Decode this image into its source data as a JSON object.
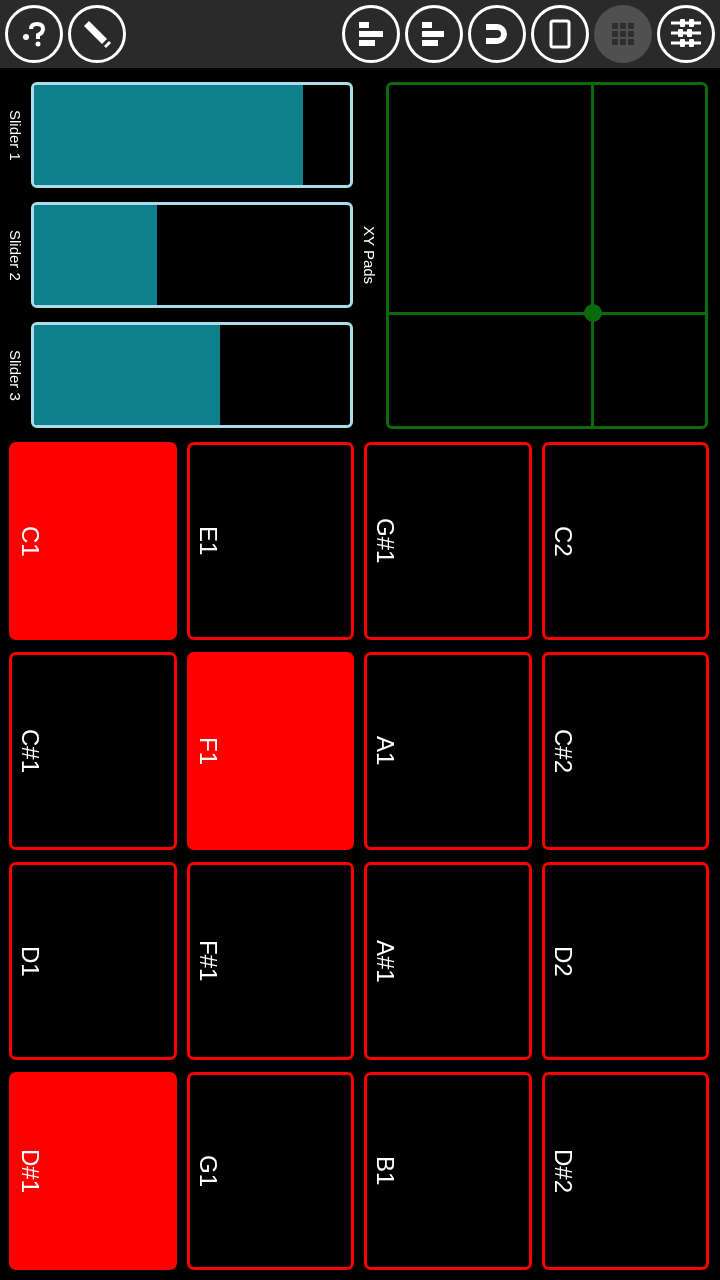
{
  "toolbar": {
    "left_buttons": [
      {
        "kind": "help",
        "selected": false
      },
      {
        "kind": "pencil",
        "selected": false
      }
    ],
    "right_buttons": [
      {
        "kind": "align-left",
        "selected": false
      },
      {
        "kind": "align-center",
        "selected": false
      },
      {
        "kind": "magnet",
        "selected": false
      },
      {
        "kind": "tablet",
        "selected": false
      },
      {
        "kind": "grid",
        "selected": true
      },
      {
        "kind": "mixer",
        "selected": false
      }
    ]
  },
  "sliders": [
    {
      "label": "Slider 1",
      "level": 0.85
    },
    {
      "label": "Slider 2",
      "level": 0.39
    },
    {
      "label": "Slider 3",
      "level": 0.59
    }
  ],
  "xy_pad": {
    "label": "XY Pads",
    "horizontal": {
      "level": 0.645
    },
    "vertical": {
      "level": 0.67
    }
  },
  "pads": [
    {
      "label": "C1",
      "on": true
    },
    {
      "label": "E1",
      "on": false
    },
    {
      "label": "G#1",
      "on": false
    },
    {
      "label": "C2",
      "on": false
    },
    {
      "label": "C#1",
      "on": false
    },
    {
      "label": "F1",
      "on": true
    },
    {
      "label": "A1",
      "on": false
    },
    {
      "label": "C#2",
      "on": false
    },
    {
      "label": "D1",
      "on": false
    },
    {
      "label": "F#1",
      "on": false
    },
    {
      "label": "A#1",
      "on": false
    },
    {
      "label": "D2",
      "on": false
    },
    {
      "label": "D#1",
      "on": true
    },
    {
      "label": "G1",
      "on": false
    },
    {
      "label": "B1",
      "on": false
    },
    {
      "label": "D#2",
      "on": false
    }
  ]
}
